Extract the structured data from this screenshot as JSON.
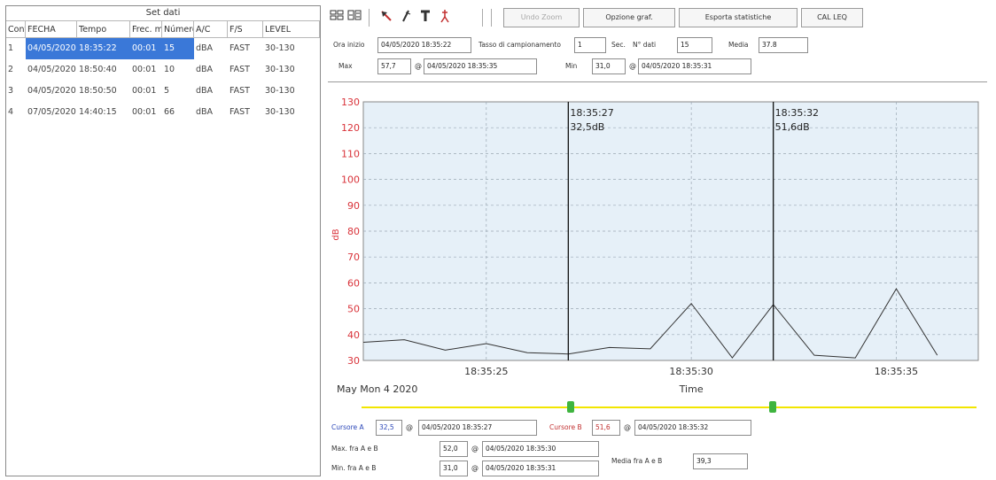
{
  "left": {
    "title": "Set dati",
    "columns": [
      "Conf",
      "FECHA",
      "Tempo",
      "Frec. m",
      "Número",
      "A/C",
      "F/S",
      "LEVEL"
    ],
    "rows": [
      {
        "conf": "1",
        "fecha": "04/05/2020",
        "tempo": "18:35:22",
        "frec": "00:01",
        "numero": "15",
        "ac": "dBA",
        "fs": "FAST",
        "level": "30-130",
        "selected": true
      },
      {
        "conf": "2",
        "fecha": "04/05/2020",
        "tempo": "18:50:40",
        "frec": "00:01",
        "numero": "10",
        "ac": "dBA",
        "fs": "FAST",
        "level": "30-130",
        "selected": false
      },
      {
        "conf": "3",
        "fecha": "04/05/2020",
        "tempo": "18:50:50",
        "frec": "00:01",
        "numero": "5",
        "ac": "dBA",
        "fs": "FAST",
        "level": "30-130",
        "selected": false
      },
      {
        "conf": "4",
        "fecha": "07/05/2020",
        "tempo": "14:40:15",
        "frec": "00:01",
        "numero": "66",
        "ac": "dBA",
        "fs": "FAST",
        "level": "30-130",
        "selected": false
      }
    ]
  },
  "toolbar": {
    "icons": [
      "bar-chart-icon",
      "line-chart-icon",
      "cursor-arrow-icon",
      "pen-cursor-icon",
      "text-tool-icon",
      "marker-icon"
    ],
    "buttons": [
      {
        "label": "Undo Zoom",
        "disabled": true
      },
      {
        "label": "Opzione graf.",
        "disabled": false
      },
      {
        "label": "Esporta statistiche",
        "disabled": false
      },
      {
        "label": "CAL LEQ",
        "disabled": false
      }
    ]
  },
  "info": {
    "ora_inizio_label": "Ora inizio",
    "ora_inizio_value": "04/05/2020 18:35:22",
    "tasso_label": "Tasso di campionamento",
    "tasso_value": "1",
    "sec_label": "Sec.",
    "ndati_label": "N° dati",
    "ndati_value": "15",
    "media_label": "Media",
    "media_value": "37.8",
    "max_label": "Max",
    "max_value": "57,7",
    "max_at_symbol": "@",
    "max_time": "04/05/2020 18:35:35",
    "min_label": "Min",
    "min_value": "31,0",
    "min_at_symbol": "@",
    "min_time": "04/05/2020 18:35:31"
  },
  "chart_data": {
    "type": "line",
    "ylabel": "dB",
    "xlabel": "Time",
    "date_label": "May Mon 4 2020",
    "ylim": [
      30,
      130
    ],
    "yticks": [
      "30",
      "40",
      "50",
      "60",
      "70",
      "80",
      "90",
      "100",
      "110",
      "120",
      "130"
    ],
    "xtick_labels": [
      "18:35:25",
      "18:35:30",
      "18:35:35"
    ],
    "xtick_seconds": [
      25,
      30,
      35
    ],
    "xlim_seconds": [
      22,
      37
    ],
    "x_seconds": [
      22,
      23,
      24,
      25,
      26,
      27,
      28,
      29,
      30,
      31,
      32,
      33,
      34,
      35,
      36
    ],
    "values": [
      37.0,
      38.0,
      34.0,
      36.5,
      33.0,
      32.5,
      35.0,
      34.5,
      52.0,
      31.0,
      51.6,
      32.0,
      31.0,
      57.7,
      32.0
    ],
    "cursors": [
      {
        "label": "18:35:27",
        "value_text": "32,5dB",
        "second": 27
      },
      {
        "label": "18:35:32",
        "value_text": "51,6dB",
        "second": 32
      }
    ],
    "grid": true,
    "colors": {
      "background": "#e6f0f8",
      "line": "#333333",
      "ytick": "#d9333a",
      "ylabel": "#d9333a",
      "cursor": "#111111"
    }
  },
  "slider": {
    "track_color": "#f2e600",
    "handle_color": "#3fb43f"
  },
  "bottom": {
    "cursore_a_label": "Cursore A",
    "cursore_a_value": "32,5",
    "cursore_a_at": "@",
    "cursore_a_time": "04/05/2020 18:35:27",
    "cursore_b_label": "Cursore B",
    "cursore_b_value": "51,6",
    "cursore_b_at": "@",
    "cursore_b_time": "04/05/2020 18:35:32",
    "max_ab_label": "Max. fra A e B",
    "max_ab_value": "52,0",
    "max_ab_at": "@",
    "max_ab_time": "04/05/2020 18:35:30",
    "min_ab_label": "Min. fra A e B",
    "min_ab_value": "31,0",
    "min_ab_at": "@",
    "min_ab_time": "04/05/2020 18:35:31",
    "media_ab_label": "Media fra A e B",
    "media_ab_value": "39,3"
  }
}
